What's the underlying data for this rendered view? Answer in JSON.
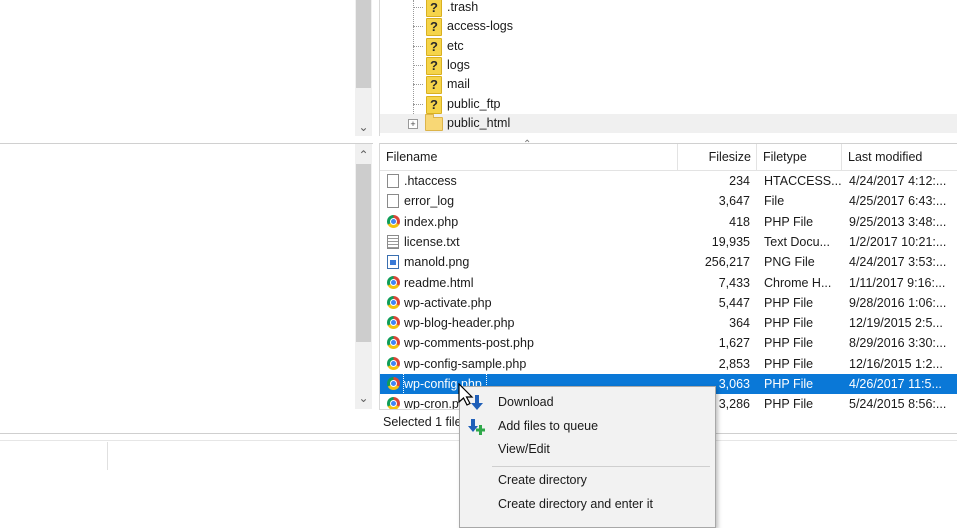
{
  "tree": {
    "items": [
      {
        "label": ".trash",
        "icon": "question-icon"
      },
      {
        "label": "access-logs",
        "icon": "question-icon"
      },
      {
        "label": "etc",
        "icon": "question-icon"
      },
      {
        "label": "logs",
        "icon": "question-icon"
      },
      {
        "label": "mail",
        "icon": "question-icon"
      },
      {
        "label": "public_ftp",
        "icon": "question-icon"
      },
      {
        "label": "public_html",
        "icon": "folder-icon",
        "expander": "+"
      }
    ]
  },
  "file_list": {
    "columns": [
      "Filename",
      "Filesize",
      "Filetype",
      "Last modified"
    ],
    "rows": [
      {
        "name": ".htaccess",
        "size": "234",
        "type": "HTACCESS...",
        "modified": "4/24/2017 4:12:...",
        "icon": "document-icon"
      },
      {
        "name": "error_log",
        "size": "3,647",
        "type": "File",
        "modified": "4/25/2017 6:43:...",
        "icon": "document-icon"
      },
      {
        "name": "index.php",
        "size": "418",
        "type": "PHP File",
        "modified": "9/25/2013 3:48:...",
        "icon": "chrome-icon"
      },
      {
        "name": "license.txt",
        "size": "19,935",
        "type": "Text Docu...",
        "modified": "1/2/2017 10:21:...",
        "icon": "text-file-icon"
      },
      {
        "name": "manold.png",
        "size": "256,217",
        "type": "PNG File",
        "modified": "4/24/2017 3:53:...",
        "icon": "image-file-icon"
      },
      {
        "name": "readme.html",
        "size": "7,433",
        "type": "Chrome H...",
        "modified": "1/11/2017 9:16:...",
        "icon": "chrome-icon"
      },
      {
        "name": "wp-activate.php",
        "size": "5,447",
        "type": "PHP File",
        "modified": "9/28/2016 1:06:...",
        "icon": "chrome-icon"
      },
      {
        "name": "wp-blog-header.php",
        "size": "364",
        "type": "PHP File",
        "modified": "12/19/2015 2:5...",
        "icon": "chrome-icon"
      },
      {
        "name": "wp-comments-post.php",
        "size": "1,627",
        "type": "PHP File",
        "modified": "8/29/2016 3:30:...",
        "icon": "chrome-icon"
      },
      {
        "name": "wp-config-sample.php",
        "size": "2,853",
        "type": "PHP File",
        "modified": "12/16/2015 1:2...",
        "icon": "chrome-icon"
      },
      {
        "name": "wp-config.php",
        "size": "3,063",
        "type": "PHP File",
        "modified": "4/26/2017 11:5...",
        "icon": "chrome-icon",
        "selected": true
      },
      {
        "name": "wp-cron.php",
        "size": "3,286",
        "type": "PHP File",
        "modified": "5/24/2015 8:56:...",
        "icon": "chrome-icon"
      }
    ]
  },
  "status": {
    "text": "Selected 1 file"
  },
  "context_menu": {
    "items": [
      {
        "label": "Download",
        "icon": "download-arrow-icon"
      },
      {
        "label": "Add files to queue",
        "icon": "add-queue-icon"
      },
      {
        "label": "View/Edit"
      },
      {
        "label": "Create directory"
      },
      {
        "label": "Create directory and enter it"
      }
    ]
  },
  "colors": {
    "selection": "#0a78d7",
    "menu_bg": "#f2f2f2"
  }
}
